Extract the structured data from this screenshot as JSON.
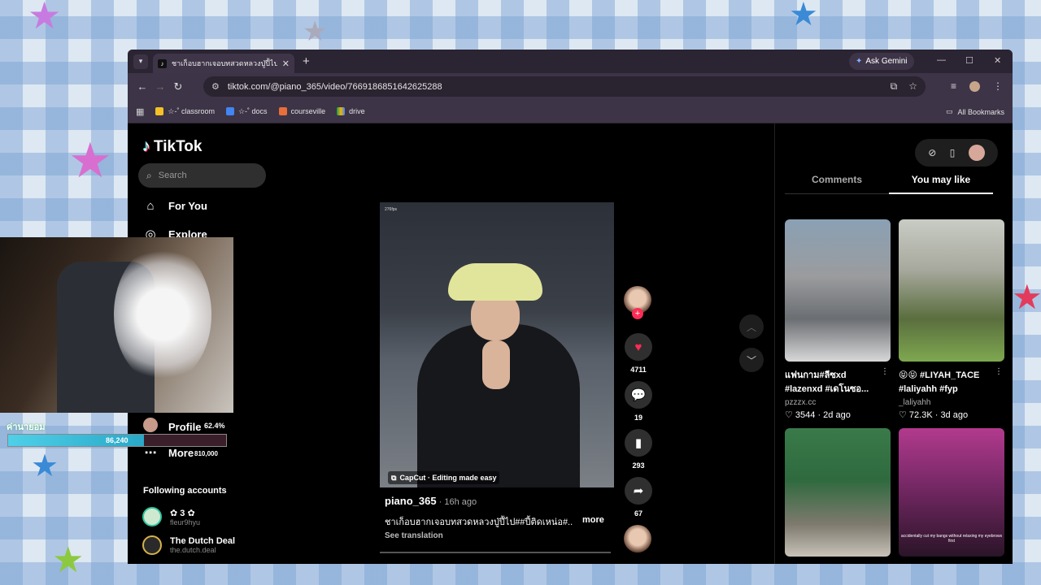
{
  "browser": {
    "tab_title": "ชาเก็อบฮากเจอบทสวดหลวงปู่ปี้ไป#ปี้",
    "ask_gemini": "Ask Gemini",
    "url": "tiktok.com/@piano_365/video/7669186851642625288",
    "bookmarks": [
      "☆-˚ classroom",
      "☆-˚ docs",
      "courseville",
      "drive"
    ],
    "all_bookmarks": "All Bookmarks"
  },
  "tiktok": {
    "logo": "TikTok",
    "search_placeholder": "Search",
    "nav": {
      "for_you": "For You",
      "explore": "Explore",
      "profile": "Profile",
      "more": "More"
    },
    "following_header": "Following accounts",
    "accounts": [
      {
        "name": "✿ 3 ✿",
        "handle": "fleur9hyu"
      },
      {
        "name": "The Dutch Deal",
        "handle": "the.dutch.deal"
      }
    ],
    "video": {
      "fps_label": "276fps",
      "watermark": "CapCut · Editing made easy",
      "author": "piano_365",
      "time": " · 16h ago",
      "caption": "ชาเก็อบฮากเจอบทสวดหลวงปู่ปี้ไป##ปี้ติดเหน่อ#...",
      "more": "more",
      "see_translation": "See translation"
    },
    "actions": {
      "likes": "4711",
      "comments": "19",
      "saves": "293",
      "shares": "67"
    },
    "panel": {
      "tabs": [
        "Comments",
        "You may like"
      ],
      "active_tab": "You may like",
      "cards": [
        {
          "title": "แฟนกาม#ลีซxd #lazenxd #เดโนซอ...",
          "user": "pzzzx.cc",
          "meta": "♡ 3544 · 2d ago"
        },
        {
          "title": "😝😝 #LIYAH_TACE #laliyahh #fyp",
          "user": "_laliyahh",
          "meta": "♡ 72.3K · 3d ago"
        },
        {
          "title": "",
          "user": "",
          "meta": ""
        },
        {
          "title": "",
          "user": "",
          "meta": "",
          "overlay": "accidentally cut my bangs without relaxing my eyebrows first"
        }
      ]
    }
  },
  "overlay": {
    "goal_label": "ค่านายอม",
    "goal_value": "86,240",
    "goal_percent": "62.4%",
    "goal_max": "810,000",
    "goal_progress": 0.624,
    "colors": {
      "fill": "#4fd0e8",
      "accent": "#fe2c55"
    }
  }
}
